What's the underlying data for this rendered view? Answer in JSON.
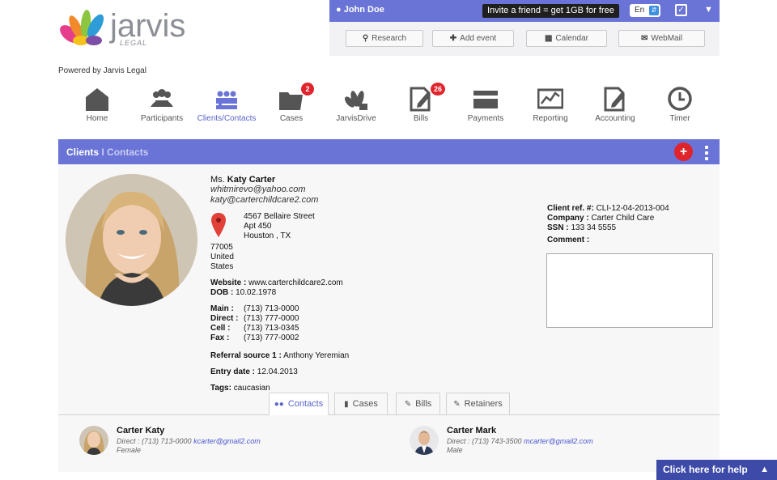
{
  "brand": {
    "name": "jarvis",
    "sub": "LEGAL",
    "powered_by": "Powered by Jarvis Legal"
  },
  "topbar": {
    "user_name": "John Doe",
    "invite": "Invite a friend = get 1GB for free",
    "language": "En"
  },
  "tools": {
    "research_placeholder": "Research",
    "add_event": "Add event",
    "calendar": "Calendar",
    "webmail": "WebMail"
  },
  "nav": {
    "home": "Home",
    "participants": "Participants",
    "clients": "Clients/Contacts",
    "cases": "Cases",
    "cases_badge": "2",
    "drive": "JarvisDrive",
    "bills": "Bills",
    "bills_badge": "26",
    "payments": "Payments",
    "reporting": "Reporting",
    "accounting": "Accounting",
    "timer": "Timer"
  },
  "header": {
    "title": "Clients",
    "separator": " I ",
    "subtitle": "Contacts",
    "add_label": "+"
  },
  "contact": {
    "salutation": "Ms.",
    "name": "Katy Carter",
    "email1": "whitmirevo@yahoo.com",
    "email2": "katy@carterchildcare2.com",
    "address_street": "4567 Bellaire Street",
    "address_apt": "Apt 450",
    "address_city": "Houston , TX",
    "address_zip": "77005",
    "address_country1": "United",
    "address_country2": "States",
    "website_label": "Website :",
    "website": "www.carterchildcare2.com",
    "dob_label": "DOB :",
    "dob": "10.02.1978",
    "phones": [
      {
        "label": "Main :",
        "value": "(713) 713-0000"
      },
      {
        "label": "Direct :",
        "value": "(713) 777-0000"
      },
      {
        "label": "Cell :",
        "value": "(713) 713-0345"
      },
      {
        "label": "Fax :",
        "value": "(713) 777-0002"
      }
    ],
    "referral_label": "Referral source 1 :",
    "referral": "Anthony Yeremian",
    "entry_label": "Entry date :",
    "entry": "12.04.2013",
    "tags_label": "Tags:",
    "tags": "caucasian",
    "client_ref_label": "Client ref. #:",
    "client_ref": "CLI-12-04-2013-004",
    "company_label": "Company :",
    "company": "Carter Child Care",
    "ssn_label": "SSN :",
    "ssn": "133 34 5555",
    "comment_label": "Comment :"
  },
  "tabs": {
    "contacts": "Contacts",
    "cases": "Cases",
    "bills": "Bills",
    "retainers": "Retainers"
  },
  "related": [
    {
      "name": "Carter Katy",
      "line_prefix": "Direct : (713) 713-0000",
      "email": "kcarter@gmail2.com",
      "gender": "Female"
    },
    {
      "name": "Carter Mark",
      "line_prefix": "Direct : (713) 743-3500",
      "email": "mcarter@gmail2.com",
      "gender": "Male"
    }
  ],
  "help": {
    "label": "Click here for help"
  },
  "colors": {
    "accent": "#6a74d6",
    "badge_red": "#e0242b",
    "help_blue": "#3d4aa8"
  }
}
